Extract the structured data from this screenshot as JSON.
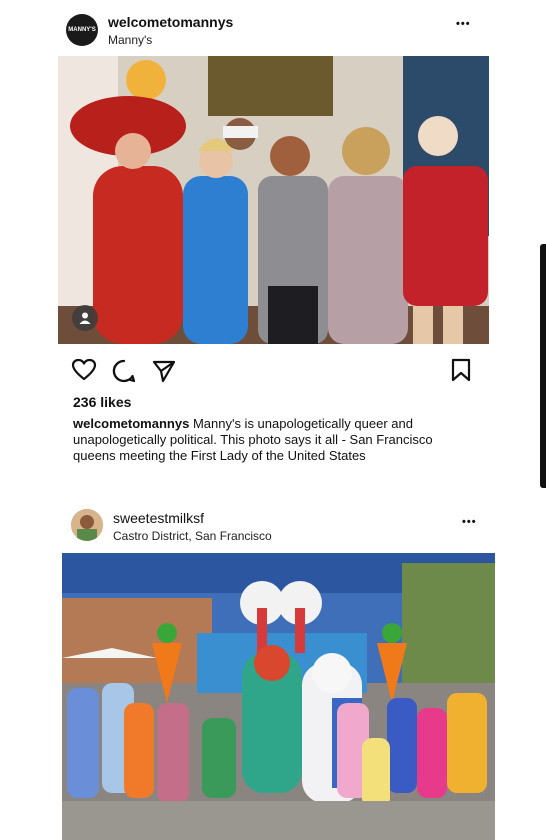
{
  "post1": {
    "username": "welcometomannys",
    "subtitle": "Manny's",
    "avatar_text": "MANNY'S",
    "more_label": "•••",
    "likes": "236 likes",
    "caption_user": "welcometomannys",
    "caption_text": " Manny's is unapologetically queer and unapologetically political. This photo says it all - San Francisco queens meeting the First Lady of the United States"
  },
  "post2": {
    "username": "sweetestmilksf",
    "subtitle": "Castro District, San Francisco",
    "more_label": "•••"
  },
  "icons": {
    "like": "heart-icon",
    "comment": "comment-icon",
    "share": "send-icon",
    "save": "bookmark-icon",
    "tag": "user-tag-icon"
  },
  "colors": {
    "text": "#111111",
    "background": "#ffffff"
  }
}
